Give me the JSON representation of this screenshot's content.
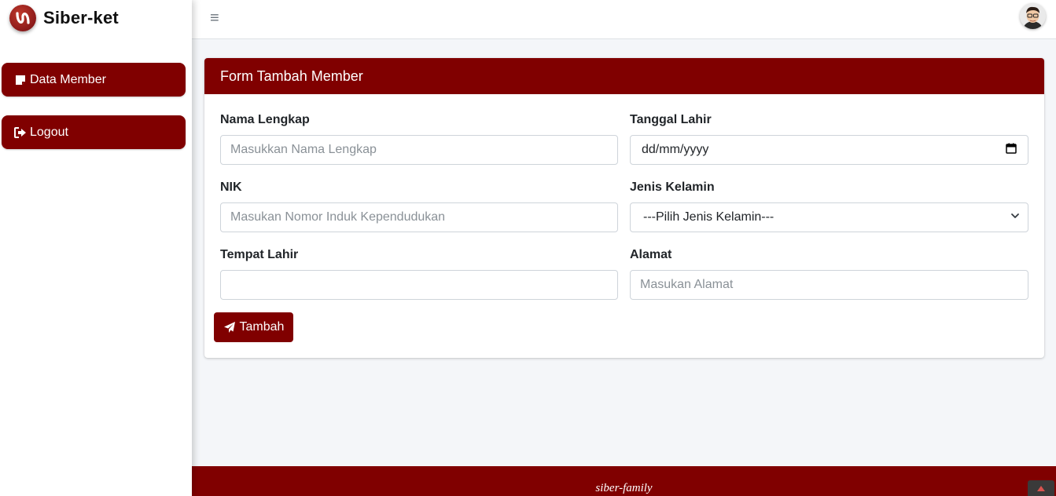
{
  "brand": {
    "title": "Siber-ket",
    "logo_icon": "brand-logo-icon"
  },
  "sidebar": {
    "items": [
      {
        "label": "Data Member",
        "icon": "note-icon"
      },
      {
        "label": "Logout",
        "icon": "sign-out-icon"
      }
    ]
  },
  "topbar": {
    "menu_icon": "hamburger-icon",
    "avatar": "user-avatar"
  },
  "form": {
    "title": "Form Tambah Member",
    "fields": {
      "nama": {
        "label": "Nama Lengkap",
        "placeholder": "Masukkan Nama Lengkap",
        "value": ""
      },
      "tanggal": {
        "label": "Tanggal Lahir",
        "placeholder": "dd/mm/yyyy"
      },
      "nik": {
        "label": "NIK",
        "placeholder": "Masukan Nomor Induk Kependudukan",
        "value": ""
      },
      "jenis_kelamin": {
        "label": "Jenis Kelamin",
        "selected": "---Pilih Jenis Kelamin---"
      },
      "tempat": {
        "label": "Tempat Lahir",
        "placeholder": "",
        "value": ""
      },
      "alamat": {
        "label": "Alamat",
        "placeholder": "Masukan Alamat",
        "value": ""
      }
    },
    "submit_label": "Tambah",
    "submit_icon": "paper-plane-icon"
  },
  "footer": {
    "text": "siber-family"
  },
  "colors": {
    "primary": "#800000",
    "background": "#f4f6f9",
    "card": "#ffffff",
    "input_border": "#ced4da"
  }
}
